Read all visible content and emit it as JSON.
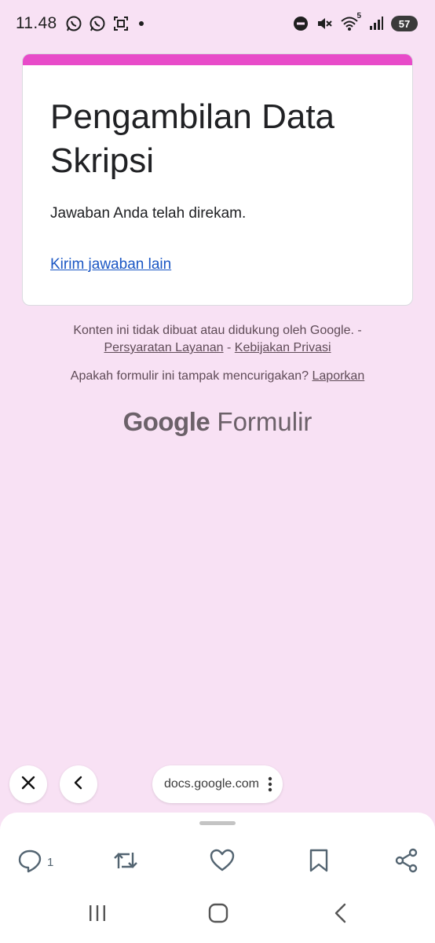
{
  "status_bar": {
    "time": "11.48",
    "left_icons": [
      "whatsapp-icon",
      "whatsapp-icon",
      "screenshot-icon",
      "dot-icon"
    ],
    "right_icons": [
      "do-not-disturb-icon",
      "mute-icon",
      "wifi-icon",
      "signal-icon"
    ],
    "wifi_label": "5",
    "battery": "57"
  },
  "form": {
    "accent_color": "#e84bc9",
    "title": "Pengambilan Data Skripsi",
    "confirmation": "Jawaban Anda telah direkam.",
    "another_response": "Kirim jawaban lain"
  },
  "footer": {
    "disclaimer": "Konten ini tidak dibuat atau didukung oleh Google. -",
    "terms": "Persyaratan Layanan",
    "separator": "-",
    "privacy": "Kebijakan Privasi",
    "report_question": "Apakah formulir ini tampak mencurigakan?",
    "report_link": "Laporkan",
    "brand_google": "Google",
    "brand_product": "Formulir"
  },
  "browser": {
    "url": "docs.google.com",
    "close_icon": "close-icon",
    "back_icon": "chevron-left-icon",
    "menu_icon": "more-vert-icon"
  },
  "actions": {
    "reply_count": "1",
    "icons": [
      "reply-icon",
      "retweet-icon",
      "like-icon",
      "bookmark-icon",
      "share-icon"
    ]
  },
  "system_nav": [
    "recent-apps-icon",
    "home-icon",
    "back-icon"
  ]
}
